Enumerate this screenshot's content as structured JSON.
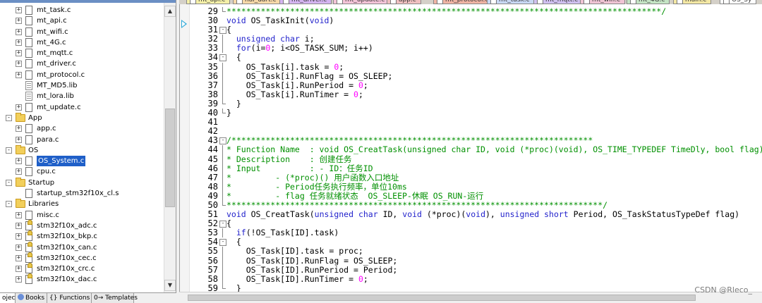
{
  "project_tree": {
    "rows": [
      {
        "type": "file",
        "label": "mt_task.c",
        "depth": 2,
        "expander": "+"
      },
      {
        "type": "file",
        "label": "mt_api.c",
        "depth": 2,
        "expander": "+"
      },
      {
        "type": "file",
        "label": "mt_wifi.c",
        "depth": 2,
        "expander": "+"
      },
      {
        "type": "file",
        "label": "mt_4G.c",
        "depth": 2,
        "expander": "+"
      },
      {
        "type": "file",
        "label": "mt_mqtt.c",
        "depth": 2,
        "expander": "+"
      },
      {
        "type": "file",
        "label": "mt_driver.c",
        "depth": 2,
        "expander": "+"
      },
      {
        "type": "file",
        "label": "mt_protocol.c",
        "depth": 2,
        "expander": "+"
      },
      {
        "type": "lib",
        "label": "MT_MD5.lib",
        "depth": 2,
        "expander": ""
      },
      {
        "type": "lib",
        "label": "mt_lora.lib",
        "depth": 2,
        "expander": ""
      },
      {
        "type": "file",
        "label": "mt_update.c",
        "depth": 2,
        "expander": "+"
      },
      {
        "type": "folder",
        "label": "App",
        "depth": 1,
        "expander": "-"
      },
      {
        "type": "file",
        "label": "app.c",
        "depth": 2,
        "expander": "+"
      },
      {
        "type": "file",
        "label": "para.c",
        "depth": 2,
        "expander": "+"
      },
      {
        "type": "folder",
        "label": "OS",
        "depth": 1,
        "expander": "-"
      },
      {
        "type": "file",
        "label": "OS_System.c",
        "depth": 2,
        "expander": "+",
        "selected": true
      },
      {
        "type": "file",
        "label": "cpu.c",
        "depth": 2,
        "expander": "+"
      },
      {
        "type": "folder",
        "label": "Startup",
        "depth": 1,
        "expander": "-"
      },
      {
        "type": "file",
        "label": "startup_stm32f10x_cl.s",
        "depth": 2,
        "expander": ""
      },
      {
        "type": "folder",
        "label": "Libraries",
        "depth": 1,
        "expander": "-"
      },
      {
        "type": "file",
        "label": "misc.c",
        "depth": 2,
        "expander": "+"
      },
      {
        "type": "hfile",
        "label": "stm32f10x_adc.c",
        "depth": 2,
        "expander": "+"
      },
      {
        "type": "hfile",
        "label": "stm32f10x_bkp.c",
        "depth": 2,
        "expander": "+"
      },
      {
        "type": "hfile",
        "label": "stm32f10x_can.c",
        "depth": 2,
        "expander": "+"
      },
      {
        "type": "hfile",
        "label": "stm32f10x_cec.c",
        "depth": 2,
        "expander": "+"
      },
      {
        "type": "hfile",
        "label": "stm32f10x_crc.c",
        "depth": 2,
        "expander": "+"
      },
      {
        "type": "hfile",
        "label": "stm32f10x_dac.c",
        "depth": 2,
        "expander": "+"
      }
    ]
  },
  "bottom_tabs": [
    {
      "label": "oject",
      "icon": "project-icon",
      "active": true
    },
    {
      "label": "Books",
      "icon": "books-icon",
      "active": false
    },
    {
      "label": "{} Functions",
      "icon": "functions-icon",
      "active": false
    },
    {
      "label": "0→ Templates",
      "icon": "templates-icon",
      "active": false
    }
  ],
  "editor_tabs": [
    {
      "label": "mt_api.c",
      "color": "#f5f0a8"
    },
    {
      "label": "hal_uart.c",
      "color": "#f8d9a8"
    },
    {
      "label": "mt_driver.c",
      "color": "#d4b4f0"
    },
    {
      "label": "mt_update.c",
      "color": "#f4c4d8"
    },
    {
      "label": "app.c",
      "color": "#f0c0c0"
    },
    {
      "label": "mt_protocol.c",
      "color": "#f0b4a4"
    },
    {
      "label": "mt_task.c",
      "color": "#c8d8f4"
    },
    {
      "label": "mt_mqtt.c",
      "color": "#d0c0f0"
    },
    {
      "label": "mt_wifi.c",
      "color": "#f0c4d4"
    },
    {
      "label": "mt_4G.c",
      "color": "#c4e4c4"
    },
    {
      "label": "main.c",
      "color": "#f4e8a4"
    },
    {
      "label": "OS_Sy",
      "color": "#ffffff"
    }
  ],
  "code_lines": [
    {
      "num": "29",
      "fold": "end",
      "spans": [
        {
          "c": "cm",
          "t": "*****************************************************************************************/"
        }
      ]
    },
    {
      "num": "30",
      "fold": "",
      "spans": [
        {
          "c": "kw",
          "t": "void"
        },
        {
          "c": "",
          "t": " OS_TaskInit("
        },
        {
          "c": "kw",
          "t": "void"
        },
        {
          "c": "",
          "t": ")"
        }
      ]
    },
    {
      "num": "31",
      "fold": "open",
      "spans": [
        {
          "c": "",
          "t": "{"
        }
      ]
    },
    {
      "num": "32",
      "fold": "bar",
      "spans": [
        {
          "c": "",
          "t": "  "
        },
        {
          "c": "kw",
          "t": "unsigned char"
        },
        {
          "c": "",
          "t": " i;"
        }
      ]
    },
    {
      "num": "33",
      "fold": "bar",
      "spans": [
        {
          "c": "",
          "t": "  "
        },
        {
          "c": "kw",
          "t": "for"
        },
        {
          "c": "",
          "t": "(i="
        },
        {
          "c": "nm",
          "t": "0"
        },
        {
          "c": "",
          "t": "; i<OS_TASK_SUM; i++)"
        }
      ]
    },
    {
      "num": "34",
      "fold": "open",
      "spans": [
        {
          "c": "",
          "t": "  {"
        }
      ]
    },
    {
      "num": "35",
      "fold": "bar",
      "spans": [
        {
          "c": "",
          "t": "    OS_Task[i].task = "
        },
        {
          "c": "nm",
          "t": "0"
        },
        {
          "c": "",
          "t": ";"
        }
      ]
    },
    {
      "num": "36",
      "fold": "bar",
      "spans": [
        {
          "c": "",
          "t": "    OS_Task[i].RunFlag = OS_SLEEP;"
        }
      ]
    },
    {
      "num": "37",
      "fold": "bar",
      "spans": [
        {
          "c": "",
          "t": "    OS_Task[i].RunPeriod = "
        },
        {
          "c": "nm",
          "t": "0"
        },
        {
          "c": "",
          "t": ";"
        }
      ]
    },
    {
      "num": "38",
      "fold": "bar",
      "spans": [
        {
          "c": "",
          "t": "    OS_Task[i].RunTimer = "
        },
        {
          "c": "nm",
          "t": "0"
        },
        {
          "c": "",
          "t": ";"
        }
      ]
    },
    {
      "num": "39",
      "fold": "end",
      "spans": [
        {
          "c": "",
          "t": "  }"
        }
      ]
    },
    {
      "num": "40",
      "fold": "end",
      "spans": [
        {
          "c": "",
          "t": "}"
        }
      ]
    },
    {
      "num": "41",
      "fold": "",
      "spans": [
        {
          "c": "",
          "t": ""
        }
      ]
    },
    {
      "num": "42",
      "fold": "",
      "spans": [
        {
          "c": "",
          "t": ""
        }
      ]
    },
    {
      "num": "43",
      "fold": "open",
      "spans": [
        {
          "c": "cm",
          "t": "/**************************************************************************"
        }
      ]
    },
    {
      "num": "44",
      "fold": "bar",
      "spans": [
        {
          "c": "cm",
          "t": "* Function Name  : void OS_CreatTask(unsigned char ID, void (*proc)(void), OS_TIME_TYPEDEF TimeDly, bool flag)"
        }
      ]
    },
    {
      "num": "45",
      "fold": "bar",
      "spans": [
        {
          "c": "cm",
          "t": "* Description    : 创建任务"
        }
      ]
    },
    {
      "num": "46",
      "fold": "bar",
      "spans": [
        {
          "c": "cm",
          "t": "* Input          : - ID：任务ID"
        }
      ]
    },
    {
      "num": "47",
      "fold": "bar",
      "spans": [
        {
          "c": "cm",
          "t": "*         - (*proc)() 用户函数入口地址"
        }
      ]
    },
    {
      "num": "48",
      "fold": "bar",
      "spans": [
        {
          "c": "cm",
          "t": "*         - Period任务执行频率，单位10ms"
        }
      ]
    },
    {
      "num": "49",
      "fold": "bar",
      "spans": [
        {
          "c": "cm",
          "t": "*         - flag 任务就绪状态  OS_SLEEP-休眠 OS_RUN-运行"
        }
      ]
    },
    {
      "num": "50",
      "fold": "end",
      "spans": [
        {
          "c": "cm",
          "t": "*****************************************************************************/"
        }
      ]
    },
    {
      "num": "51",
      "fold": "",
      "spans": [
        {
          "c": "kw",
          "t": "void"
        },
        {
          "c": "",
          "t": " OS_CreatTask("
        },
        {
          "c": "kw",
          "t": "unsigned char"
        },
        {
          "c": "",
          "t": " ID, "
        },
        {
          "c": "kw",
          "t": "void"
        },
        {
          "c": "",
          "t": " (*proc)("
        },
        {
          "c": "kw",
          "t": "void"
        },
        {
          "c": "",
          "t": "), "
        },
        {
          "c": "kw",
          "t": "unsigned short"
        },
        {
          "c": "",
          "t": " Period, OS_TaskStatusTypeDef flag)"
        }
      ]
    },
    {
      "num": "52",
      "fold": "open",
      "spans": [
        {
          "c": "",
          "t": "{"
        }
      ]
    },
    {
      "num": "53",
      "fold": "bar",
      "spans": [
        {
          "c": "",
          "t": "  "
        },
        {
          "c": "kw",
          "t": "if"
        },
        {
          "c": "",
          "t": "(!OS_Task[ID].task)"
        }
      ]
    },
    {
      "num": "54",
      "fold": "open",
      "spans": [
        {
          "c": "",
          "t": "  {"
        }
      ]
    },
    {
      "num": "55",
      "fold": "bar",
      "spans": [
        {
          "c": "",
          "t": "    OS_Task[ID].task = proc;"
        }
      ]
    },
    {
      "num": "56",
      "fold": "bar",
      "spans": [
        {
          "c": "",
          "t": "    OS_Task[ID].RunFlag = OS_SLEEP;"
        }
      ]
    },
    {
      "num": "57",
      "fold": "bar",
      "spans": [
        {
          "c": "",
          "t": "    OS_Task[ID].RunPeriod = Period;"
        }
      ]
    },
    {
      "num": "58",
      "fold": "bar",
      "spans": [
        {
          "c": "",
          "t": "    OS_Task[ID].RunTimer = "
        },
        {
          "c": "nm",
          "t": "0"
        },
        {
          "c": "",
          "t": ";"
        }
      ]
    },
    {
      "num": "59",
      "fold": "end",
      "spans": [
        {
          "c": "",
          "t": "  }"
        }
      ]
    }
  ],
  "watermark": "CSDN @Rleco_",
  "colors": {
    "keyword": "#2323cc",
    "comment": "#009000",
    "number": "#ff00ff",
    "selection": "#1f5fc8"
  }
}
